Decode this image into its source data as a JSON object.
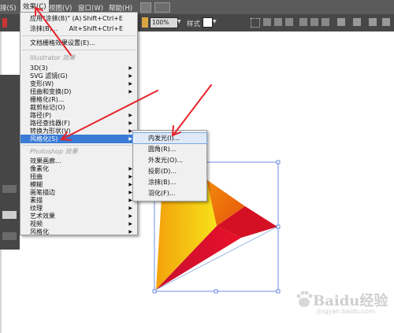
{
  "menubar": {
    "items": [
      "择(S)",
      "效果(C)",
      "视图(V)",
      "窗口(W)",
      "帮助(H)"
    ],
    "active_index": 1
  },
  "toolbar": {
    "opacity_value": "100%",
    "style_label": "样式"
  },
  "effect_menu": {
    "top_items": [
      {
        "label": "应用\"涂抹(B)\" (A)",
        "shortcut": "Shift+Ctrl+E"
      },
      {
        "label": "涂抹(B)...",
        "shortcut": "Alt+Shift+Ctrl+E"
      }
    ],
    "doc_settings": "文档栅格效果设置(E)...",
    "illustrator_group": "Illustrator 效果",
    "illustrator_items": [
      {
        "label": "3D(3)",
        "submenu": true
      },
      {
        "label": "SVG 滤镜(G)",
        "submenu": true
      },
      {
        "label": "变形(W)",
        "submenu": true
      },
      {
        "label": "扭曲和变换(D)",
        "submenu": true
      },
      {
        "label": "栅格化(R)...",
        "submenu": false
      },
      {
        "label": "裁剪标记(O)",
        "submenu": false
      },
      {
        "label": "路径(P)",
        "submenu": true
      },
      {
        "label": "路径查找器(F)",
        "submenu": true
      },
      {
        "label": "转换为形状(V)",
        "submenu": true
      },
      {
        "label": "风格化(S)",
        "submenu": true,
        "highlighted": true
      }
    ],
    "photoshop_group": "Photoshop 效果",
    "photoshop_items": [
      {
        "label": "效果画廊...",
        "submenu": false
      },
      {
        "label": "像素化",
        "submenu": true
      },
      {
        "label": "扭曲",
        "submenu": true
      },
      {
        "label": "模糊",
        "submenu": true
      },
      {
        "label": "画笔描边",
        "submenu": true
      },
      {
        "label": "素描",
        "submenu": true
      },
      {
        "label": "纹理",
        "submenu": true
      },
      {
        "label": "艺术效果",
        "submenu": true
      },
      {
        "label": "视频",
        "submenu": true
      },
      {
        "label": "风格化",
        "submenu": true
      }
    ]
  },
  "stylize_submenu": {
    "items": [
      {
        "label": "内发光(I)...",
        "highlighted": true
      },
      {
        "label": "圆角(R)..."
      },
      {
        "label": "外发光(O)..."
      },
      {
        "label": "投影(D)..."
      },
      {
        "label": "涂抹(B)..."
      },
      {
        "label": "羽化(F)..."
      }
    ]
  },
  "colors": {
    "menubar_bg": "#5b5b5b",
    "menu_bg": "#f0f0f0",
    "highlight": "#3a7bd5",
    "arrow_red": "#e8232a",
    "selection_blue": "#4a72d8"
  },
  "watermark": {
    "text": "Baidu经验",
    "sub": "jingyan.baidu.com"
  }
}
